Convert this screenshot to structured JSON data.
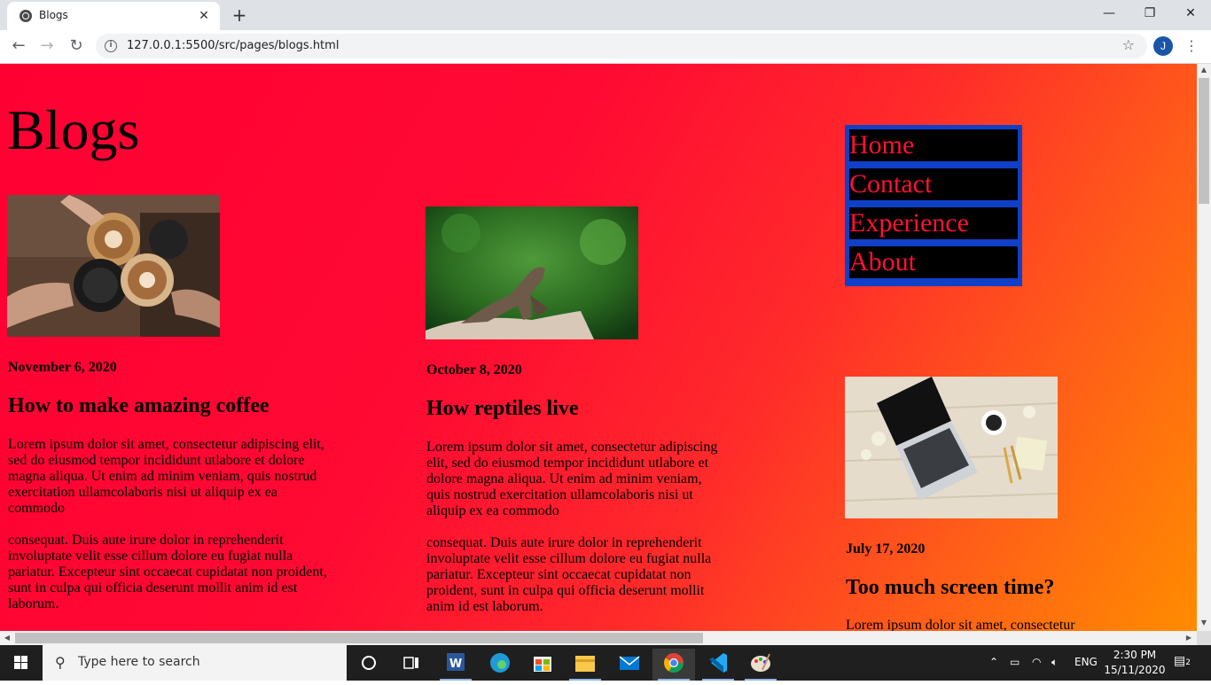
{
  "browser": {
    "tab_title": "Blogs",
    "tab_close": "✕",
    "new_tab": "+",
    "url": "127.0.0.1:5500/src/pages/blogs.html",
    "profile_initial": "J",
    "window_controls": {
      "minimize": "—",
      "restore": "❐",
      "close": "✕"
    }
  },
  "page": {
    "heading": "Blogs",
    "nav": [
      "Home",
      "Contact",
      "Experience",
      "About"
    ],
    "posts": [
      {
        "date": "November 6, 2020",
        "title": "How to make amazing coffee",
        "body1": "Lorem ipsum dolor sit amet, consectetur adipiscing elit, sed do eiusmod tempor incididunt utlabore et dolore magna aliqua. Ut enim ad minim veniam, quis nostrud exercitation ullamcolaboris nisi ut aliquip ex ea commodo",
        "body2": "consequat. Duis aute irure dolor in reprehenderit involuptate velit esse cillum dolore eu fugiat nulla pariatur. Excepteur sint occaecat cupidatat non proident, sunt in culpa qui officia deserunt mollit anim id est laborum.",
        "image": "coffee-cups-photo"
      },
      {
        "date": "October 8, 2020",
        "title": "How reptiles live",
        "body1": "Lorem ipsum dolor sit amet, consectetur adipiscing elit, sed do eiusmod tempor incididunt utlabore et dolore magna aliqua. Ut enim ad minim veniam, quis nostrud exercitation ullamcolaboris nisi ut aliquip ex ea commodo",
        "body2": "consequat. Duis aute irure dolor in reprehenderit involuptate velit esse cillum dolore eu fugiat nulla pariatur. Excepteur sint occaecat cupidatat non proident, sunt in culpa qui officia deserunt mollit anim id est laborum.",
        "image": "lizard-photo"
      },
      {
        "date": "July 17, 2020",
        "title": "Too much screen time?",
        "body1": "Lorem ipsum dolor sit amet, consectetur",
        "image": "laptop-desk-photo"
      }
    ]
  },
  "taskbar": {
    "search_placeholder": "Type here to search",
    "language": "ENG",
    "time": "2:30 PM",
    "date": "15/11/2020",
    "notification_count": "2"
  },
  "colors": {
    "nav_bg": "#1040c8",
    "nav_item_bg": "#000000",
    "nav_text": "#ff1133",
    "page_gradient_start": "#ff0033",
    "page_gradient_end": "#ff8c00"
  }
}
